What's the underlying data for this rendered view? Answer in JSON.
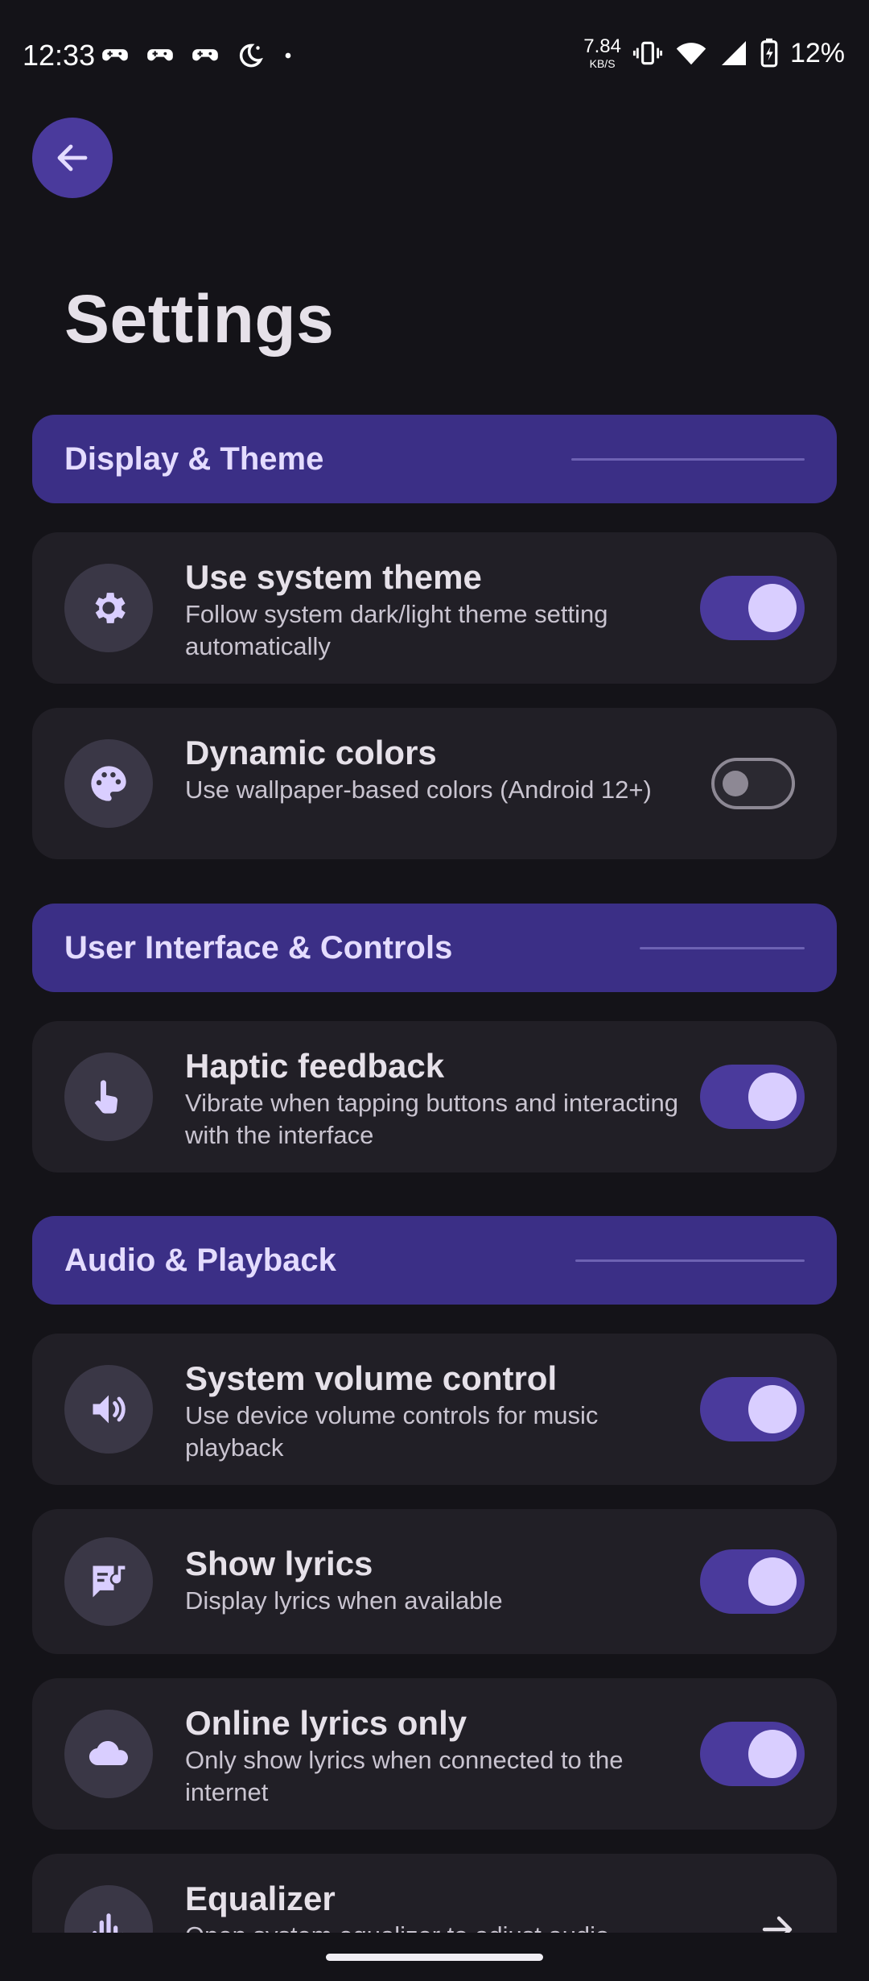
{
  "status_bar": {
    "time": "12:33",
    "net_speed_value": "7.84",
    "net_speed_unit": "KB/S",
    "battery": "12%"
  },
  "page": {
    "title": "Settings"
  },
  "sections": {
    "display": {
      "label": "Display & Theme"
    },
    "ui": {
      "label": "User Interface & Controls"
    },
    "audio": {
      "label": "Audio & Playback"
    }
  },
  "settings": {
    "system_theme": {
      "title": "Use system theme",
      "subtitle": "Follow system dark/light theme setting automatically",
      "enabled": true,
      "icon": "gear-icon"
    },
    "dynamic_colors": {
      "title": "Dynamic colors",
      "subtitle": "Use wallpaper-based colors (Android 12+)",
      "enabled": false,
      "icon": "palette-icon"
    },
    "haptic": {
      "title": "Haptic feedback",
      "subtitle": "Vibrate when tapping buttons and interacting with the interface",
      "enabled": true,
      "icon": "touch-icon"
    },
    "system_volume": {
      "title": "System volume control",
      "subtitle": "Use device volume controls for music playback",
      "enabled": true,
      "icon": "volume-icon"
    },
    "show_lyrics": {
      "title": "Show lyrics",
      "subtitle": "Display lyrics when available",
      "enabled": true,
      "icon": "lyrics-icon"
    },
    "online_lyrics": {
      "title": "Online lyrics only",
      "subtitle": "Only show lyrics when connected to the internet",
      "enabled": true,
      "icon": "cloud-icon"
    },
    "equalizer": {
      "title": "Equalizer",
      "subtitle": "Open system equalizer to adjust audio",
      "icon": "equalizer-icon"
    }
  },
  "colors": {
    "background": "#141318",
    "card": "#211f26",
    "section_header": "#3b2f86",
    "accent": "#4a3a9c",
    "knob": "#d9ceff"
  }
}
